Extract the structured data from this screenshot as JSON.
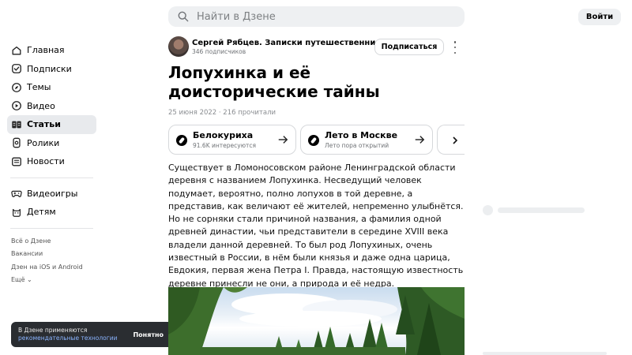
{
  "header": {
    "search_placeholder": "Найти в Дзене",
    "login_label": "Войти"
  },
  "sidebar": {
    "items": [
      {
        "label": "Главная",
        "icon": "home-icon"
      },
      {
        "label": "Подписки",
        "icon": "subscriptions-icon"
      },
      {
        "label": "Темы",
        "icon": "compass-icon"
      },
      {
        "label": "Видео",
        "icon": "video-icon"
      },
      {
        "label": "Статьи",
        "icon": "articles-icon",
        "active": true
      },
      {
        "label": "Ролики",
        "icon": "shorts-icon"
      },
      {
        "label": "Новости",
        "icon": "news-icon"
      }
    ],
    "extra_items": [
      {
        "label": "Видеоигры",
        "icon": "gamepad-icon"
      },
      {
        "label": "Детям",
        "icon": "kids-icon"
      }
    ],
    "footer_links": [
      "Всё о Дзене",
      "Вакансии",
      "Дзен на iOS и Android",
      "Ещё"
    ]
  },
  "cookie_toast": {
    "text": "В Дзене применяются",
    "link": "рекомендательные технологии",
    "button": "Понятно"
  },
  "author": {
    "name": "Сергей Рябцев. Записки путешественника",
    "subscribers": "346 подписчиков",
    "subscribe_label": "Подписаться"
  },
  "article": {
    "title": "Лопухинка и её доисторические тайны",
    "meta": "25 июня 2022 · 216 прочитали",
    "body": "Существует в Ломоносовском районе Ленинградской области деревня с названием Лопухинка. Несведущий человек подумает, вероятно, полно лопухов в той деревне, а представив, как величают её жителей, непременно улыбнётся. Но не сорняки стали причиной названия, а фамилия одной древней династии, чьи представители в середине XVIII века владели данной деревней. То был род Лопухиных, очень известный в России, в нём были князья и даже одна царица, Евдокия, первая жена Петра I. Правда, настоящую известность деревне принесли не они, а природа и её недра."
  },
  "topics": [
    {
      "name": "Белокуриха",
      "sub": "91.6K интересуются"
    },
    {
      "name": "Лето в Москве",
      "sub": "Лето пора открытий"
    }
  ],
  "colors": {
    "background": "#ffffff",
    "search_bg": "#eef0f2",
    "active_nav_bg": "#e8eaed",
    "toast_bg": "#2a2d31",
    "toast_link": "#8ab4ff"
  }
}
